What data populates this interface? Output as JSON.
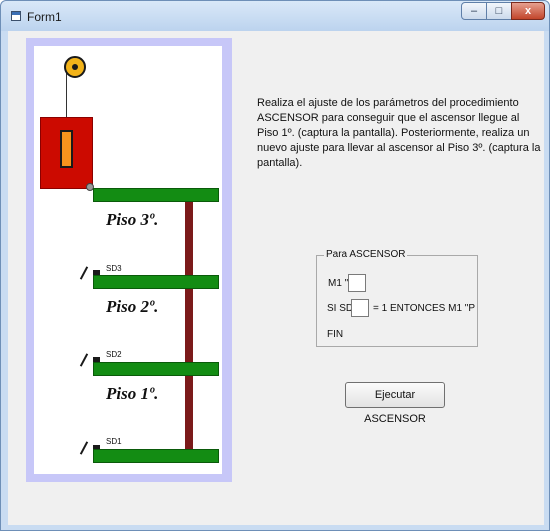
{
  "window": {
    "title": "Form1",
    "minimize_label": "–",
    "maximize_label": "□",
    "close_label": "x"
  },
  "elevator": {
    "floors": [
      {
        "label": "Piso 3º."
      },
      {
        "label": "Piso 2º."
      },
      {
        "label": "Piso 1º."
      }
    ],
    "sensors": [
      "SD3",
      "SD2",
      "SD1"
    ],
    "colors": {
      "car": "#cc0a00",
      "car_window": "#f7941d",
      "floor": "#138c13",
      "pole": "#7b1a1a",
      "pulley": "#f2b31a",
      "shaft_frame": "#c7c7f8"
    }
  },
  "instructions": "Realiza el ajuste de los parámetros del procedimiento ASCENSOR para conseguir que el ascensor llegue al Piso 1º. (captura la pantalla). Posteriormente, realiza un nuevo ajuste para llevar al ascensor al Piso 3º. (captura la pantalla).",
  "procedure": {
    "title": "Para ASCENSOR",
    "m1_label": "M1 \"",
    "m1_value": "",
    "si_label": "SI SD",
    "sd_value": "",
    "then_label": "= 1 ENTONCES M1 \"P",
    "end_label": "FIN"
  },
  "execute_button": "Ejecutar ASCENSOR"
}
